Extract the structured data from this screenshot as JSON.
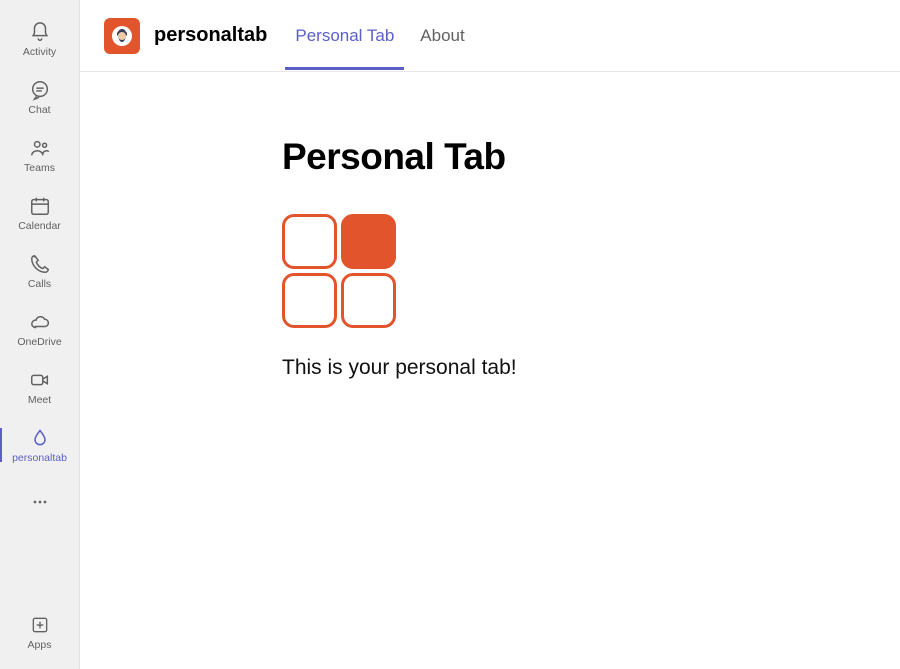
{
  "sidebar": {
    "items": [
      {
        "label": "Activity"
      },
      {
        "label": "Chat"
      },
      {
        "label": "Teams"
      },
      {
        "label": "Calendar"
      },
      {
        "label": "Calls"
      },
      {
        "label": "OneDrive"
      },
      {
        "label": "Meet"
      },
      {
        "label": "personaltab"
      }
    ],
    "apps_label": "Apps"
  },
  "header": {
    "app_name": "personaltab",
    "tabs": [
      {
        "label": "Personal Tab"
      },
      {
        "label": "About"
      }
    ]
  },
  "content": {
    "heading": "Personal Tab",
    "description": "This is your personal tab!"
  },
  "colors": {
    "accent": "#5b5fc7",
    "brand_orange": "#e2552c"
  }
}
